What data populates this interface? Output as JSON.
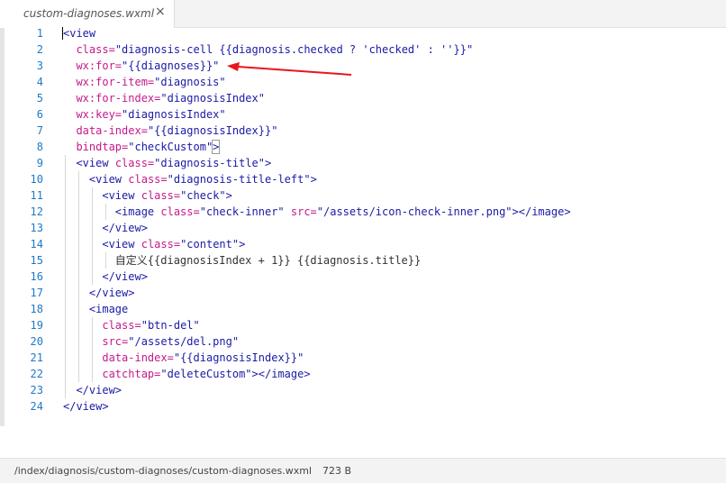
{
  "tab": {
    "filename": "custom-diagnoses.wxml",
    "close_icon": "×"
  },
  "editor": {
    "line_numbers": [
      "1",
      "2",
      "3",
      "4",
      "5",
      "6",
      "7",
      "8",
      "9",
      "10",
      "11",
      "12",
      "13",
      "14",
      "15",
      "16",
      "17",
      "18",
      "19",
      "20",
      "21",
      "22",
      "23",
      "24"
    ],
    "code": {
      "l1_open": "<",
      "l1_tag": "view",
      "l2_attr": "class=",
      "l2_val": "\"diagnosis-cell {{diagnosis.checked ? 'checked' : ''}}\"",
      "l3_attr": "wx:for=",
      "l3_val": "\"{{diagnoses}}\"",
      "l4_attr": "wx:for-item=",
      "l4_val": "\"diagnosis\"",
      "l5_attr": "wx:for-index=",
      "l5_val": "\"diagnosisIndex\"",
      "l6_attr": "wx:key=",
      "l6_val": "\"diagnosisIndex\"",
      "l7_attr": "data-index=",
      "l7_val": "\"{{diagnosisIndex}}\"",
      "l8_attr": "bindtap=",
      "l8_val": "\"checkCustom\"",
      "l8_close": ">",
      "l9_tag": "<view ",
      "l9_attr": "class=",
      "l9_val": "\"diagnosis-title\"",
      "l9_close": ">",
      "l10_tag": "<view ",
      "l10_attr": "class=",
      "l10_val": "\"diagnosis-title-left\"",
      "l10_close": ">",
      "l11_tag": "<view ",
      "l11_attr": "class=",
      "l11_val": "\"check\"",
      "l11_close": ">",
      "l12_tag": "<image ",
      "l12_attr1": "class=",
      "l12_val1": "\"check-inner\"",
      "l12_attr2": " src=",
      "l12_val2": "\"/assets/icon-check-inner.png\"",
      "l12_close": "></image>",
      "l13": "</view>",
      "l14_tag": "<view ",
      "l14_attr": "class=",
      "l14_val": "\"content\"",
      "l14_close": ">",
      "l15": "自定义{{diagnosisIndex + 1}} {{diagnosis.title}}",
      "l16": "</view>",
      "l17": "</view>",
      "l18": "<image",
      "l19_attr": "class=",
      "l19_val": "\"btn-del\"",
      "l20_attr": "src=",
      "l20_val": "\"/assets/del.png\"",
      "l21_attr": "data-index=",
      "l21_val": "\"{{diagnosisIndex}}\"",
      "l22_attr": "catchtap=",
      "l22_val": "\"deleteCustom\"",
      "l22_close": "></image>",
      "l23": "</view>",
      "l24": "</view>"
    },
    "arrow_color": "#e8161b"
  },
  "status": {
    "path": "/index/diagnosis/custom-diagnoses/custom-diagnoses.wxml",
    "size": "723 B"
  }
}
